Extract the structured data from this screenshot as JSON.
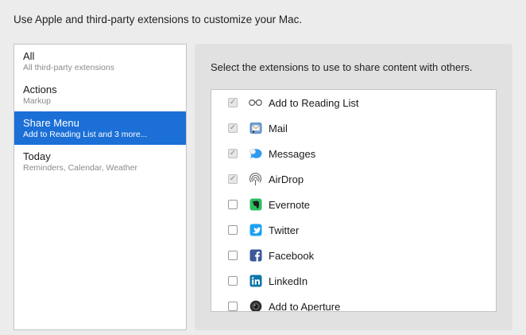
{
  "header": {
    "text": "Use Apple and third-party extensions to customize your Mac."
  },
  "sidebar": {
    "items": [
      {
        "title": "All",
        "subtitle": "All third-party extensions",
        "selected": false
      },
      {
        "title": "Actions",
        "subtitle": "Markup",
        "selected": false
      },
      {
        "title": "Share Menu",
        "subtitle": "Add to Reading List and 3 more...",
        "selected": true
      },
      {
        "title": "Today",
        "subtitle": "Reminders, Calendar, Weather",
        "selected": false
      }
    ]
  },
  "panel": {
    "description": "Select the extensions to use to share content with others.",
    "extensions": [
      {
        "label": "Add to Reading List",
        "checked": true,
        "disabled": true,
        "icon": "reading-list-icon"
      },
      {
        "label": "Mail",
        "checked": true,
        "disabled": true,
        "icon": "mail-icon"
      },
      {
        "label": "Messages",
        "checked": true,
        "disabled": true,
        "icon": "messages-icon"
      },
      {
        "label": "AirDrop",
        "checked": true,
        "disabled": true,
        "icon": "airdrop-icon"
      },
      {
        "label": "Evernote",
        "checked": false,
        "disabled": false,
        "icon": "evernote-icon"
      },
      {
        "label": "Twitter",
        "checked": false,
        "disabled": false,
        "icon": "twitter-icon"
      },
      {
        "label": "Facebook",
        "checked": false,
        "disabled": false,
        "icon": "facebook-icon"
      },
      {
        "label": "LinkedIn",
        "checked": false,
        "disabled": false,
        "icon": "linkedin-icon"
      },
      {
        "label": "Add to Aperture",
        "checked": false,
        "disabled": false,
        "icon": "aperture-icon"
      }
    ]
  },
  "colors": {
    "selection": "#1b6fd6",
    "twitter": "#1da1f2",
    "facebook": "#3b5998",
    "linkedin": "#0e76a8",
    "evernote": "#2dbe60"
  }
}
